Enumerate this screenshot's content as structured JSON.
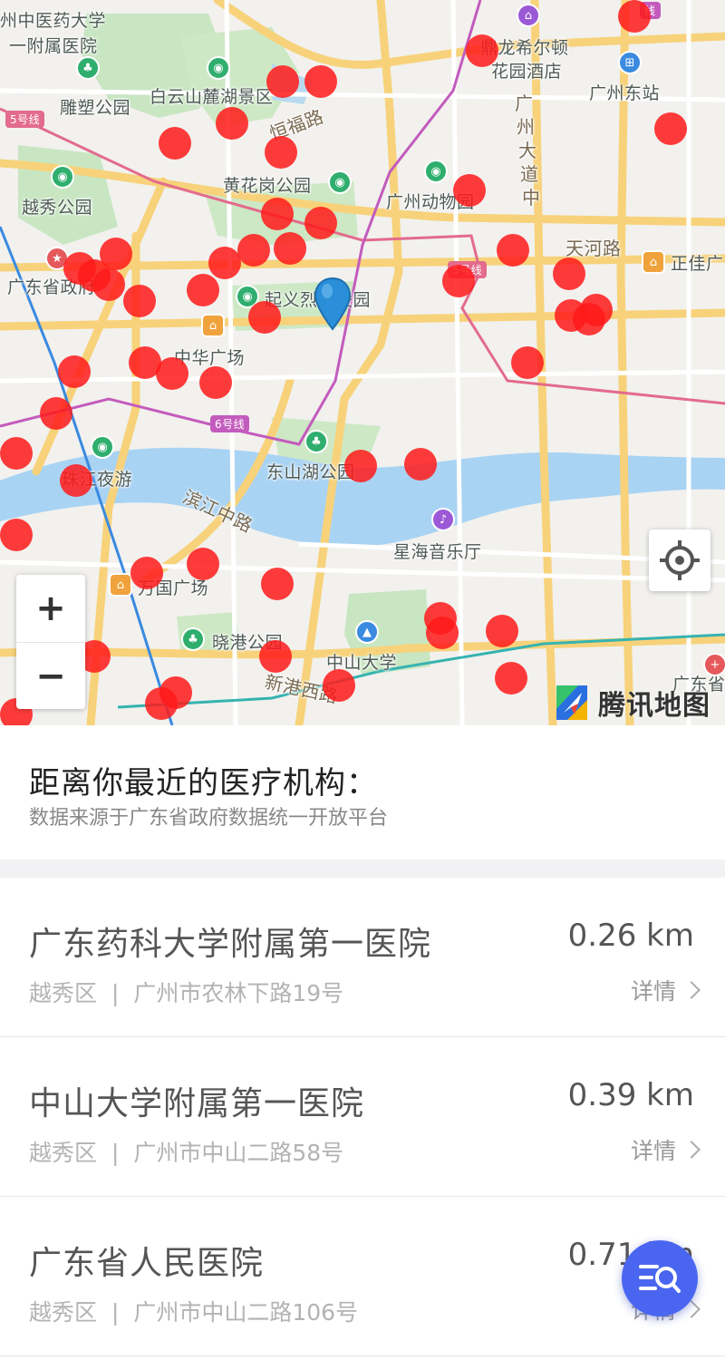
{
  "map": {
    "labels": {
      "hosp_top_1": "州中医药大学",
      "hosp_top_2": "一附属医院",
      "diaosu": "雕塑公园",
      "baiyun": "白云山麓湖景区",
      "henfu": "恒福路",
      "huanghuagang": "黄花岗公园",
      "zoo": "广州动物园",
      "yuexiu": "越秀公园",
      "gov": "广东省政府",
      "qiyi": "起义烈士陵园",
      "zhonghua": "中华广场",
      "dongshanhu": "东山湖公园",
      "zhujiang": "珠江夜游",
      "binjiang": "滨江中路",
      "xinghai": "星海音乐厅",
      "wanguo": "万国广场",
      "xiaogang": "晓港公园",
      "zhongshan": "中山大学",
      "xingang": "新港西路",
      "hotel_1": "鼎龙希尔顿",
      "hotel_2": "花园酒店",
      "gz_east": "广州东站",
      "gz_ave_1": "广",
      "gz_ave_2": "州",
      "gz_ave_3": "大",
      "gz_ave_4": "道",
      "gz_ave_5": "中",
      "tianhe": "天河路",
      "zhengjia": "正佳广",
      "metro5a": "5号线",
      "metro5b": "5号线",
      "metro6": "6号线",
      "xian": "线",
      "gd_right": "广东省"
    },
    "zoom_in": "+",
    "zoom_out": "−",
    "logo_text": "腾讯地图",
    "dot_color": "#ff1a1a",
    "pin_color": "#2a8fd8"
  },
  "info": {
    "title": "距离你最近的医疗机构：",
    "subtitle": "数据来源于广东省政府数据统一开放平台"
  },
  "list": [
    {
      "name": "广东药科大学附属第一医院",
      "distance": "0.26 km",
      "district": "越秀区",
      "separator": "|",
      "address": "广州市农林下路19号",
      "detail": "详情"
    },
    {
      "name": "中山大学附属第一医院",
      "distance": "0.39 km",
      "district": "越秀区",
      "separator": "|",
      "address": "广州市中山二路58号",
      "detail": "详情"
    },
    {
      "name": "广东省人民医院",
      "distance": "0.71 km",
      "district": "越秀区",
      "separator": "|",
      "address": "广州市中山二路106号",
      "detail": "详情"
    }
  ],
  "fab": {
    "icon": "search-list-icon",
    "color": "#4a66f0"
  }
}
